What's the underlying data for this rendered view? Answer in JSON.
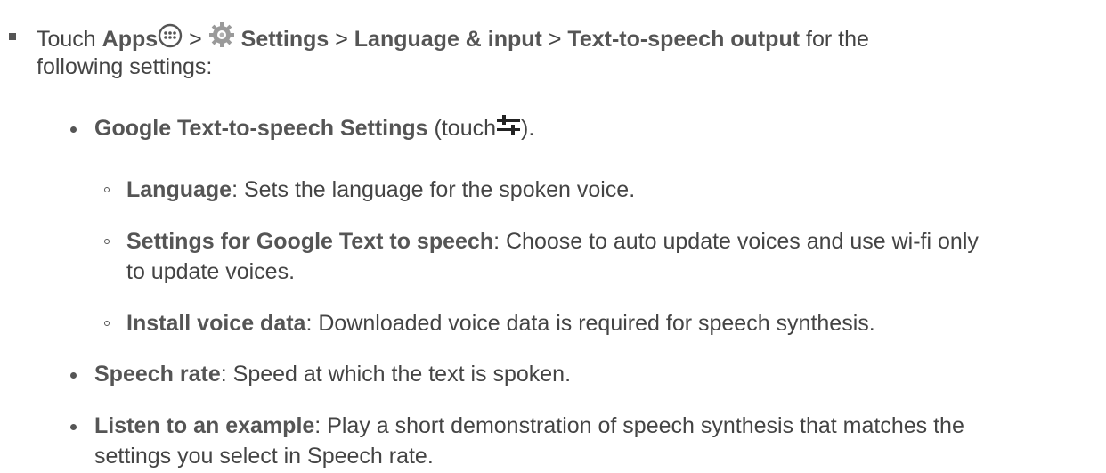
{
  "intro": {
    "touch": "Touch",
    "apps": "Apps",
    "sep1": ">",
    "settings": "Settings",
    "sep2": ">",
    "language_input": "Language & input",
    "sep3": ">",
    "tts_output": "Text-to-speech output",
    "tail_line1": "for the",
    "tail_line2": "following settings:"
  },
  "items": {
    "google_tts": {
      "label": "Google Text-to-speech Settings",
      "touch_before": "(touch",
      "touch_after": ")."
    },
    "language": {
      "label": "Language",
      "desc": ": Sets the language for the spoken voice."
    },
    "google_settings": {
      "label": "Settings for Google Text to speech",
      "desc1": ": Choose to auto update voices and use wi-fi only",
      "desc2": "to update voices."
    },
    "install_voice": {
      "label": "Install voice data",
      "desc": ": Downloaded voice data is required for speech synthesis."
    },
    "speech_rate": {
      "label": "Speech rate",
      "desc": ": Speed at which the text is spoken."
    },
    "listen": {
      "label": "Listen to an example",
      "desc1": ": Play a short demonstration of speech synthesis that matches the",
      "desc2": "settings you select in Speech rate."
    }
  },
  "icons": {
    "apps": "apps-grid-icon",
    "settings": "gear-icon",
    "tune": "sliders-icon"
  }
}
